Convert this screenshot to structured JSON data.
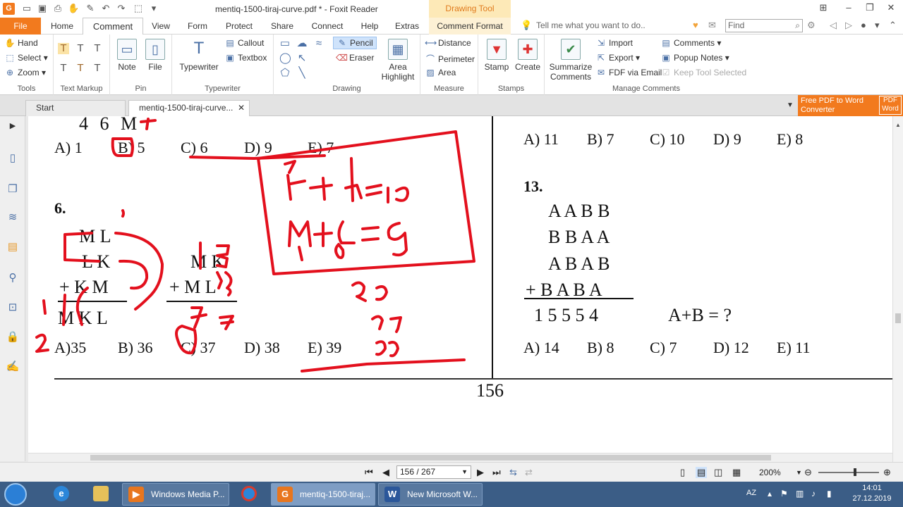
{
  "window": {
    "title": "mentiq-1500-tiraj-curve.pdf * - Foxit Reader",
    "contextual_tab": "Drawing Tool"
  },
  "menu": {
    "file": "File",
    "tabs": [
      "Home",
      "Comment",
      "View",
      "Form",
      "Protect",
      "Share",
      "Connect",
      "Help",
      "Extras",
      "Comment Format"
    ],
    "tell_me": "Tell me what you want to do..",
    "find_placeholder": "Find"
  },
  "ribbon": {
    "tools": {
      "label": "Tools",
      "hand": "Hand",
      "select": "Select",
      "zoom": "Zoom"
    },
    "text_markup": {
      "label": "Text Markup"
    },
    "pin": {
      "label": "Pin",
      "note": "Note",
      "file": "File"
    },
    "typewriter": {
      "label": "Typewriter",
      "typewriter": "Typewriter",
      "callout": "Callout",
      "textbox": "Textbox"
    },
    "drawing": {
      "label": "Drawing",
      "pencil": "Pencil",
      "eraser": "Eraser",
      "area_highlight": "Area Highlight"
    },
    "measure": {
      "label": "Measure",
      "distance": "Distance",
      "perimeter": "Perimeter",
      "area": "Area"
    },
    "stamps": {
      "label": "Stamps",
      "stamp": "Stamp",
      "create": "Create"
    },
    "manage": {
      "label": "Manage Comments",
      "summarize": "Summarize Comments",
      "import": "Import",
      "export": "Export",
      "fdf_email": "FDF via Email",
      "comments": "Comments",
      "popup_notes": "Popup Notes",
      "keep_tool": "Keep Tool Selected"
    }
  },
  "doc_tabs": {
    "start": "Start",
    "doc": "mentiq-1500-tiraj-curve..."
  },
  "ad": {
    "line1": "Free PDF to Word",
    "line2": "Converter",
    "logo1": "PDF",
    "logo2": "Word"
  },
  "page": {
    "top_row": "4   6   M",
    "q5_answers": [
      "A) 1",
      "B) 5",
      "C) 6",
      "D) 9",
      "E) 7"
    ],
    "q6_number": "6.",
    "q6_row1": "M  L",
    "q6_row2": "L  K",
    "q6_row3": "+ K  M",
    "q6_result": "M K  L",
    "q6b_row1": "M  K",
    "q6b_row2": "+ M  L",
    "q6_answers": [
      "A)35",
      "B) 36",
      "C) 37",
      "D) 38",
      "E) 39"
    ],
    "q12_answers": [
      "A) 11",
      "B) 7",
      "C) 10",
      "D) 9",
      "E) 8"
    ],
    "q13_number": "13.",
    "q13_rows": [
      "A A B B",
      "B B A A",
      "A B A B",
      "+  B A B A"
    ],
    "q13_result": "1 5 5 5 4",
    "q13_question": "A+B = ?",
    "q13_answers": [
      "A) 14",
      "B) 8",
      "C) 7",
      "D) 12",
      "E) 11"
    ],
    "page_number": "156"
  },
  "ink_color": "#e3101d",
  "status": {
    "page_field": "156 / 267",
    "zoom": "200%"
  },
  "taskbar": {
    "windows": [
      "Windows Media P...",
      "mentiq-1500-tiraj...",
      "New Microsoft W..."
    ],
    "lang": "AZ",
    "time": "14:01",
    "date": "27.12.2019"
  }
}
